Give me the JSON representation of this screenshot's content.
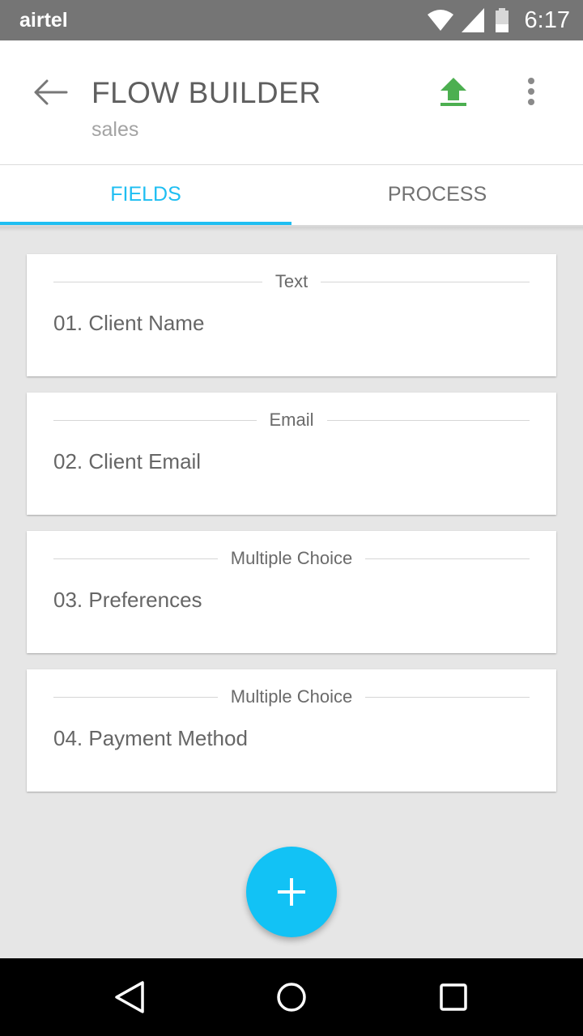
{
  "status_bar": {
    "carrier": "airtel",
    "time": "6:17"
  },
  "app_bar": {
    "title": "FLOW BUILDER",
    "subtitle": "sales",
    "icons": {
      "back": "arrow-back-icon",
      "upload": "upload-icon",
      "more": "more-vert-icon"
    },
    "upload_color": "#4caf50"
  },
  "tabs": [
    {
      "label": "FIELDS",
      "active": true
    },
    {
      "label": "PROCESS",
      "active": false
    }
  ],
  "accent_color": "#1ebef2",
  "fields": [
    {
      "type": "Text",
      "name": "01. Client Name"
    },
    {
      "type": "Email",
      "name": "02. Client Email"
    },
    {
      "type": "Multiple Choice",
      "name": "03. Preferences"
    },
    {
      "type": "Multiple Choice",
      "name": "04. Payment Method"
    }
  ],
  "fab": {
    "icon": "plus-icon"
  },
  "nav_bar": {
    "icons": [
      "back-triangle-icon",
      "home-circle-icon",
      "recents-square-icon"
    ]
  }
}
